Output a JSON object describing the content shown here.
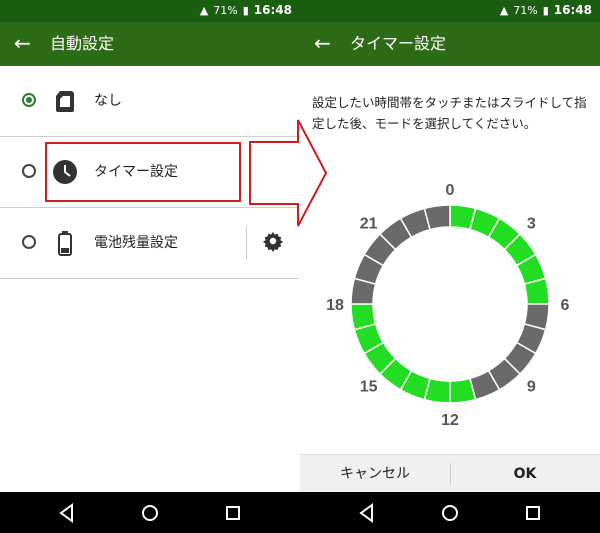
{
  "status": {
    "battery": "71%",
    "time": "16:48"
  },
  "left": {
    "title": "自動設定",
    "rows": [
      {
        "label": "なし",
        "selected": true,
        "icon": "sim-card-icon"
      },
      {
        "label": "タイマー設定",
        "selected": false,
        "icon": "clock-icon"
      },
      {
        "label": "電池残量設定",
        "selected": false,
        "icon": "battery-icon"
      }
    ]
  },
  "right": {
    "title": "タイマー設定",
    "instruction": "設定したい時間帯をタッチまたはスライドして指定した後、モードを選択してください。",
    "hour_labels": [
      "0",
      "3",
      "6",
      "9",
      "12",
      "15",
      "18",
      "21"
    ],
    "active_color": "#22dd22",
    "inactive_color": "#6a6a6a",
    "segments_per_hour": 1,
    "active_hours": [
      0,
      1,
      2,
      3,
      4,
      5,
      11,
      12,
      13,
      14,
      15,
      16,
      17
    ],
    "cancel_label": "キャンセル",
    "ok_label": "OK"
  },
  "colors": {
    "statusbar": "#1b5e12",
    "appbar": "#2e6b16",
    "highlight": "#d01c1c"
  }
}
